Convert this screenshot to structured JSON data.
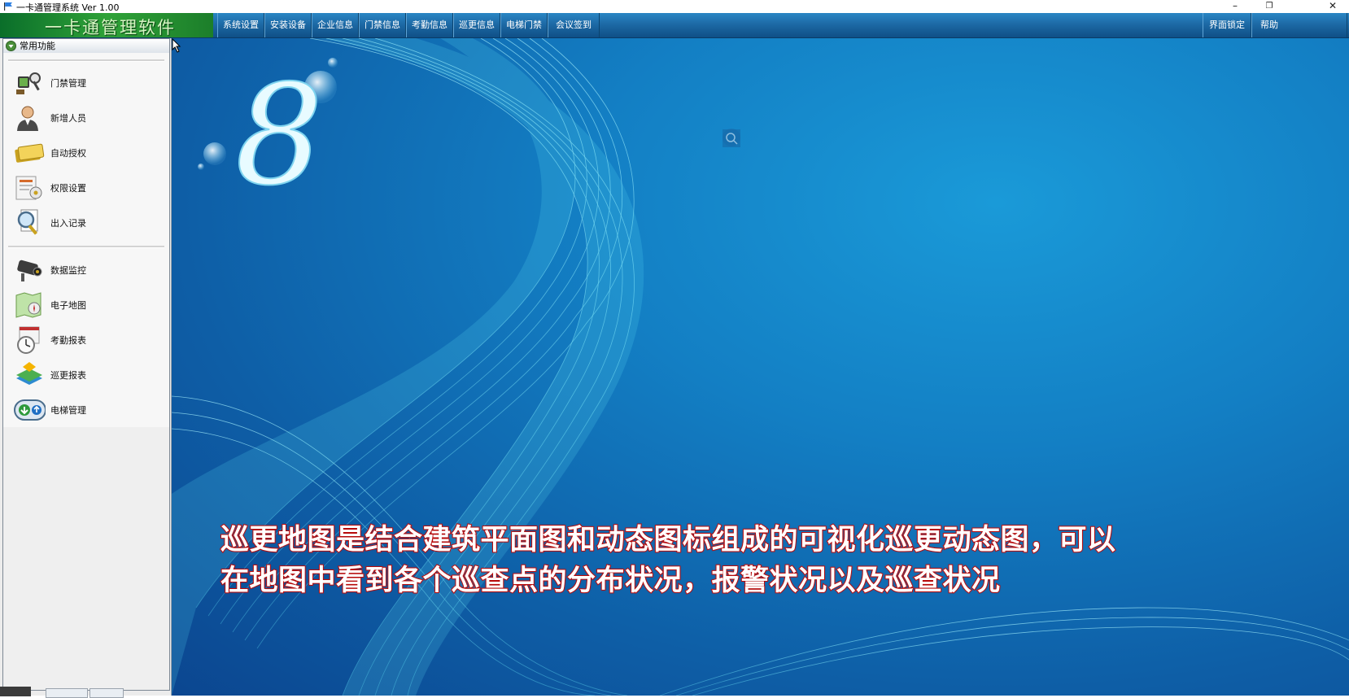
{
  "window": {
    "title": "一卡通管理系统  Ver 1.00",
    "controls": [
      "–",
      "❐",
      "✕"
    ]
  },
  "brand": {
    "text": "一卡通管理软件"
  },
  "menu": {
    "items": [
      "系统设置",
      "安装设备",
      "企业信息",
      "门禁信息",
      "考勤信息",
      "巡更信息",
      "电梯门禁",
      "会议签到"
    ],
    "right_items": [
      "界面锁定",
      "帮助"
    ]
  },
  "sidebar": {
    "header": "常用功能",
    "group1": [
      {
        "label": "门禁管理",
        "icon": "door-access-icon"
      },
      {
        "label": "新增人员",
        "icon": "person-icon"
      },
      {
        "label": "自动授权",
        "icon": "card-icon"
      },
      {
        "label": "权限设置",
        "icon": "permission-icon"
      },
      {
        "label": "出入记录",
        "icon": "magnifier-document-icon"
      }
    ],
    "group2": [
      {
        "label": "数据监控",
        "icon": "camera-icon"
      },
      {
        "label": "电子地图",
        "icon": "map-icon"
      },
      {
        "label": "考勤报表",
        "icon": "clock-calendar-icon"
      },
      {
        "label": "巡更报表",
        "icon": "patrol-icon"
      },
      {
        "label": "电梯管理",
        "icon": "elevator-icon"
      }
    ]
  },
  "main": {
    "logo_text": "8",
    "subtitle_line1": "巡更地图是结合建筑平面图和动态图标组成的可视化巡更动态图，可以",
    "subtitle_line2": "在地图中看到各个巡查点的分布状况，报警状况以及巡查状况"
  },
  "colors": {
    "menubar": "#1d6aa6",
    "brand_green": "#2fa238",
    "main_blue": "#137fc4",
    "subtitle_stroke": "#c01010"
  }
}
